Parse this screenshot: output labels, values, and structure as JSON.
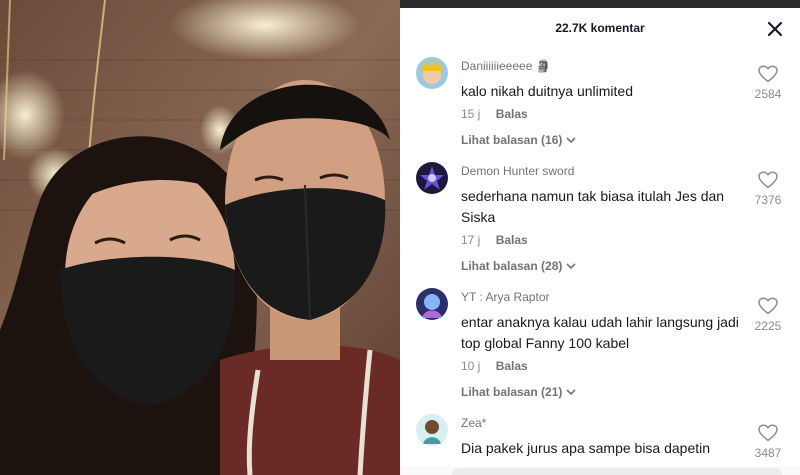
{
  "header": {
    "comment_count": "22.7K komentar"
  },
  "comments": [
    {
      "username": "Daniiiiiieeeee 🗿",
      "text": "kalo nikah duitnya unlimited",
      "time": "15 j",
      "reply_label": "Balas",
      "replies": "Lihat balasan (16)",
      "likes": "2584"
    },
    {
      "username": "Demon Hunter sword",
      "text": "sederhana namun tak biasa itulah Jes dan Siska",
      "time": "17 j",
      "reply_label": "Balas",
      "replies": "Lihat balasan (28)",
      "likes": "7376"
    },
    {
      "username": "YT : Arya Raptor",
      "text": "entar anaknya kalau udah lahir langsung jadi top global Fanny 100 kabel",
      "time": "10 j",
      "reply_label": "Balas",
      "replies": "Lihat balasan (21)",
      "likes": "2225"
    },
    {
      "username": "Zea*",
      "text": "Dia pakek jurus apa sampe bisa dapetin",
      "likes": "3487"
    }
  ],
  "icons": {
    "close": "close-icon",
    "like": "heart-outline-icon",
    "expand": "chevron-down-icon"
  },
  "colors": {
    "text": "#161823",
    "secondary": "#8a8b91",
    "username": "#737373"
  }
}
